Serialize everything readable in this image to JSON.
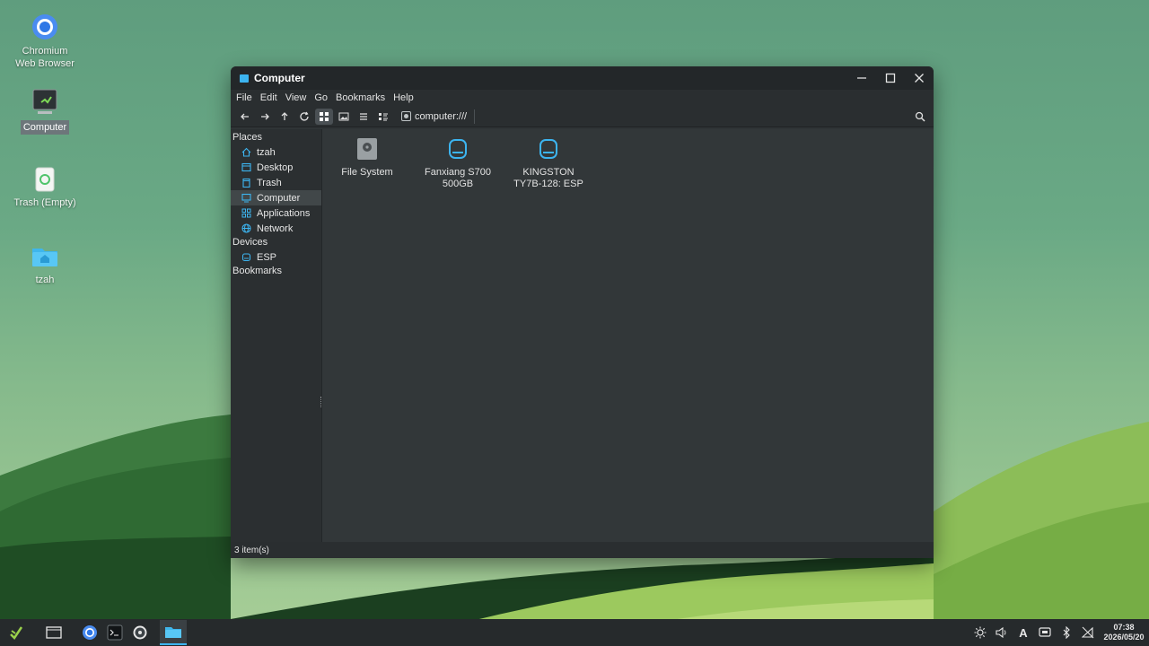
{
  "desktop": {
    "icons": [
      {
        "label": "Chromium Web Browser",
        "line1": "Chromium",
        "line2": "Web Browser"
      },
      {
        "label": "Computer"
      },
      {
        "label": "Trash (Empty)"
      },
      {
        "label": "tzah"
      }
    ]
  },
  "window": {
    "title": "Computer",
    "menu": [
      "File",
      "Edit",
      "View",
      "Go",
      "Bookmarks",
      "Help"
    ],
    "location": "computer:///",
    "sidebar": {
      "places_heading": "Places",
      "places": [
        "tzah",
        "Desktop",
        "Trash",
        "Computer",
        "Applications",
        "Network"
      ],
      "devices_heading": "Devices",
      "devices": [
        "ESP"
      ],
      "bookmarks_heading": "Bookmarks"
    },
    "files": [
      {
        "line1": "File System",
        "line2": ""
      },
      {
        "line1": "Fanxiang S700",
        "line2": "500GB"
      },
      {
        "line1": "KINGSTON",
        "line2": "TY7B-128: ESP"
      }
    ],
    "status": "3 item(s)"
  },
  "taskbar": {
    "time": "07:38",
    "date": "2026/05/20",
    "keyboard_indicator": "A"
  },
  "colors": {
    "accent": "#3cb4f0",
    "window_bg": "#323739",
    "sidebar_bg": "#2b2f31",
    "titlebar_bg": "#232729",
    "taskbar_bg": "#262a2c"
  }
}
